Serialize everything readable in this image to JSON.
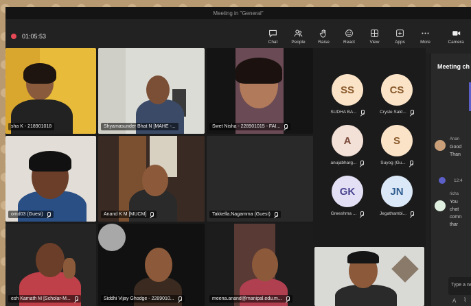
{
  "window": {
    "title": "Meeting in \"General\""
  },
  "toolbar": {
    "timer": "01:05:53",
    "tools": [
      {
        "label": "Chat",
        "icon": "chat-icon"
      },
      {
        "label": "People",
        "icon": "people-icon"
      },
      {
        "label": "Raise",
        "icon": "raise-hand-icon"
      },
      {
        "label": "React",
        "icon": "react-icon"
      },
      {
        "label": "View",
        "icon": "view-icon"
      },
      {
        "label": "Apps",
        "icon": "apps-icon"
      },
      {
        "label": "More",
        "icon": "more-icon"
      },
      {
        "label": "Camera",
        "icon": "camera-icon"
      }
    ]
  },
  "video_tiles": [
    {
      "name": "sha K - 218901018"
    },
    {
      "name": "Shyamasunder Bhat N [MAHE -..."
    },
    {
      "name": "Swet Nisha - 228901015 - FAI..."
    },
    {
      "name": "omd03 (Guest)"
    },
    {
      "name": "Anand K M [MUCM]"
    },
    {
      "name": "Takkella.Nagamma (Guest)"
    },
    {
      "name": "esh Kamath M [Scholar-M..."
    },
    {
      "name": "Siddhi Vijay Ghodge - 2289010..."
    },
    {
      "name": "meena.anand@manipal.edu.m..."
    }
  ],
  "avatars": [
    {
      "initials": "SS",
      "name": "SUDHA BA...",
      "bg": "#fbe3c8",
      "fg": "#8a5a2b"
    },
    {
      "initials": "CS",
      "name": "Crysle Sald...",
      "bg": "#fbe3c8",
      "fg": "#8a5a2b"
    },
    {
      "initials": "A",
      "name": "anujabharg...",
      "bg": "#f3e0d6",
      "fg": "#7a4a3a"
    },
    {
      "initials": "S",
      "name": "Suyog (Gu...",
      "bg": "#fbe3c8",
      "fg": "#8a5a2b"
    },
    {
      "initials": "GK",
      "name": "Greeshma ...",
      "bg": "#e3e0f5",
      "fg": "#4b4691"
    },
    {
      "initials": "JN",
      "name": "Jegathambi...",
      "bg": "#dbe8f7",
      "fg": "#2f5d8f"
    }
  ],
  "chat": {
    "title": "Meeting ch",
    "messages": [
      {
        "sender": "Anan",
        "lines": [
          "Good",
          "Than"
        ]
      },
      {
        "sender": "richa",
        "lines": [
          "You",
          "chat",
          "comn",
          "thar"
        ]
      }
    ],
    "time_fragment": "12:4",
    "input_placeholder": "Type a ne"
  }
}
